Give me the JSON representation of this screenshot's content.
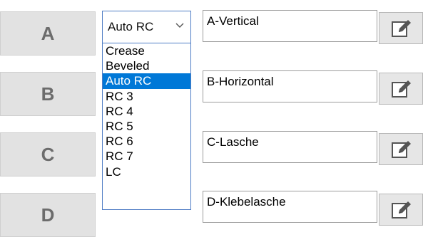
{
  "rows": [
    {
      "letter": "A",
      "name": "A-Vertical"
    },
    {
      "letter": "B",
      "name": "B-Horizontal"
    },
    {
      "letter": "C",
      "name": "C-Lasche"
    },
    {
      "letter": "D",
      "name": "D-Klebelasche"
    }
  ],
  "type_select": {
    "value": "Auto RC",
    "options": [
      "Crease",
      "Beveled",
      "Auto RC",
      "RC 3",
      "RC 4",
      "RC 5",
      "RC 6",
      "RC 7",
      "LC"
    ],
    "selected_option": "Auto RC"
  },
  "icons": {
    "edit_button": "edit-pencil-icon",
    "select_arrow": "chevron-down-icon"
  },
  "colors": {
    "highlight": "#0078d7",
    "select_border": "#4f7dc5",
    "letter_button_bg": "#e2e2e2"
  }
}
